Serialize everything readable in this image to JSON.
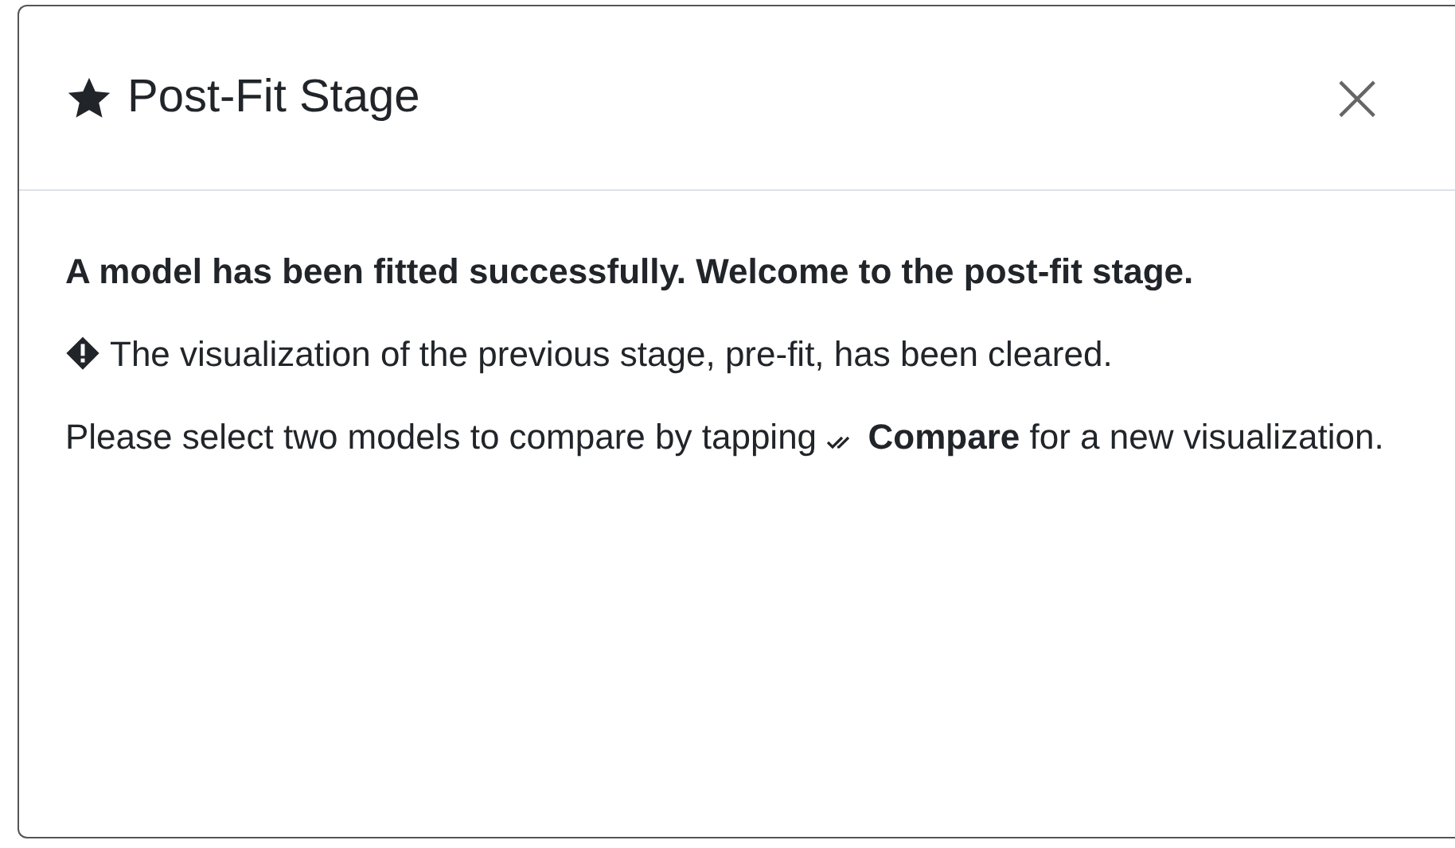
{
  "modal": {
    "title": "Post-Fit Stage",
    "close": "×",
    "messages": [
      {
        "kind": "bold",
        "text": "A model has been fitted successfully. Welcome to the post-fit stage."
      },
      {
        "kind": "warning",
        "text": "The visualization of the previous stage, pre-fit, has been cleared."
      },
      {
        "kind": "action",
        "text_before": "Please select two models to compare by tapping",
        "text_after": "**Compare** for a new visualization."
      }
    ]
  }
}
